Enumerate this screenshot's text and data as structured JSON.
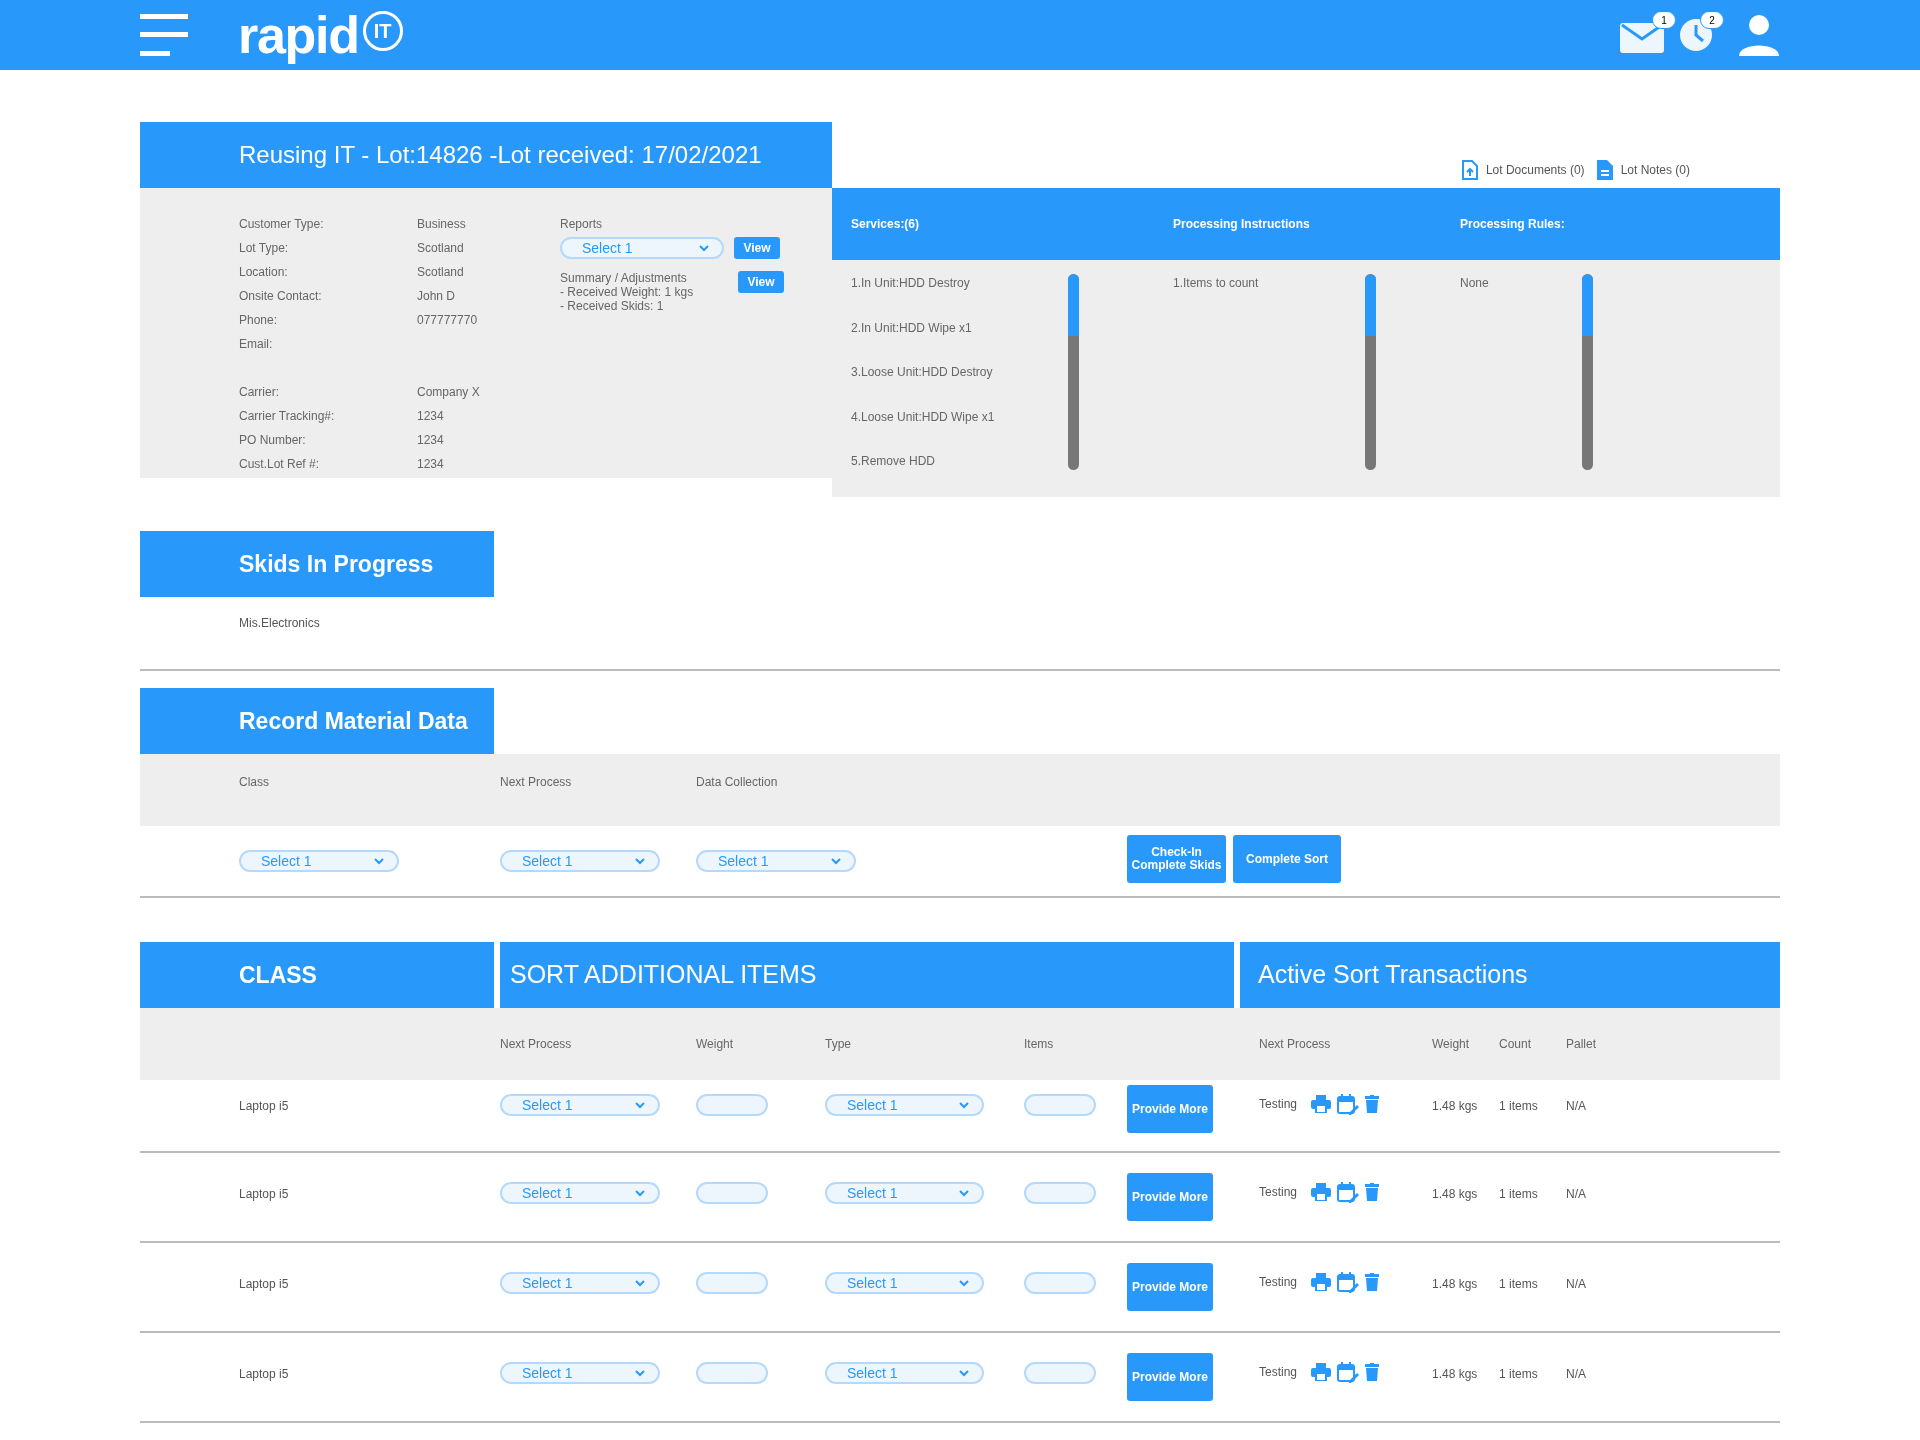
{
  "header": {
    "logo": {
      "word": "rapid",
      "mark": "IT"
    },
    "notifications": [
      {
        "kind": "mail",
        "count": "1"
      },
      {
        "kind": "clock",
        "count": "2"
      }
    ]
  },
  "lot": {
    "title": "Reusing IT - Lot:14826 -Lot received: 17/02/2021",
    "links": [
      {
        "kind": "upload",
        "label": "Lot Documents (0)"
      },
      {
        "kind": "notes",
        "label": "Lot Notes (0)"
      }
    ],
    "field_groups": [
      [
        {
          "label": "Customer Type:",
          "value": "Business"
        },
        {
          "label": "Lot Type:",
          "value": "Scotland"
        },
        {
          "label": "Location:",
          "value": "Scotland"
        },
        {
          "label": "Onsite Contact:",
          "value": "John D"
        },
        {
          "label": "Phone:",
          "value": "077777770"
        },
        {
          "label": "Email:"
        }
      ],
      [
        {
          "label": "Carrier:",
          "value": "Company X"
        },
        {
          "label": "Carrier Tracking#:",
          "value": "1234"
        },
        {
          "label": "PO Number:",
          "value": "1234"
        },
        {
          "label": "Cust.Lot Ref #:",
          "value": "1234"
        }
      ]
    ],
    "reports": {
      "label": "Reports",
      "select": "Select 1",
      "button": "View"
    },
    "summary": {
      "lines": [
        "Summary / Adjustments",
        "- Received Weight: 1 kgs",
        "- Received Skids: 1"
      ],
      "button": "View"
    },
    "panels": [
      {
        "title": "Services:(6)",
        "items": [
          "1.In Unit:HDD Destroy",
          "2.In Unit:HDD Wipe x1",
          "3.Loose Unit:HDD Destroy",
          "4.Loose Unit:HDD Wipe x1",
          "5.Remove HDD"
        ]
      },
      {
        "title": "Processing Instructions",
        "items": [
          "1.Items to count"
        ]
      },
      {
        "title": "Processing Rules:",
        "items": [
          "None"
        ]
      }
    ]
  },
  "skids": {
    "title": "Skids In Progress",
    "items": [
      "Mis.Electronics"
    ]
  },
  "record": {
    "title": "Record Material Data",
    "fields": [
      {
        "label": "Class",
        "select": "Select 1"
      },
      {
        "label": "Next Process",
        "select": "Select 1"
      },
      {
        "label": "Data Collection",
        "select": "Select 1"
      }
    ],
    "buttons": [
      "Check-In Complete Skids",
      "Complete Sort"
    ]
  },
  "sort": {
    "headers": [
      "CLASS",
      "SORT ADDITIONAL ITEMS",
      "Active Sort Transactions"
    ],
    "columns": [
      "Next Process",
      "Weight",
      "Type",
      "Items"
    ],
    "active_columns": [
      "Next Process",
      "Weight",
      "Count",
      "Pallet"
    ],
    "rows": [
      {
        "class": "Laptop i5",
        "next_process": "Select 1",
        "type": "Select 1",
        "button": "Provide More",
        "active": {
          "next_process": "Testing",
          "weight": "1.48 kgs",
          "count": "1 items",
          "pallet": "N/A"
        }
      },
      {
        "class": "Laptop i5",
        "next_process": "Select 1",
        "type": "Select 1",
        "button": "Provide More",
        "active": {
          "next_process": "Testing",
          "weight": "1.48 kgs",
          "count": "1 items",
          "pallet": "N/A"
        }
      },
      {
        "class": "Laptop i5",
        "next_process": "Select 1",
        "type": "Select 1",
        "button": "Provide More",
        "active": {
          "next_process": "Testing",
          "weight": "1.48 kgs",
          "count": "1 items",
          "pallet": "N/A"
        }
      },
      {
        "class": "Laptop i5",
        "next_process": "Select 1",
        "type": "Select 1",
        "button": "Provide More",
        "active": {
          "next_process": "Testing",
          "weight": "1.48 kgs",
          "count": "1 items",
          "pallet": "N/A"
        }
      }
    ]
  }
}
